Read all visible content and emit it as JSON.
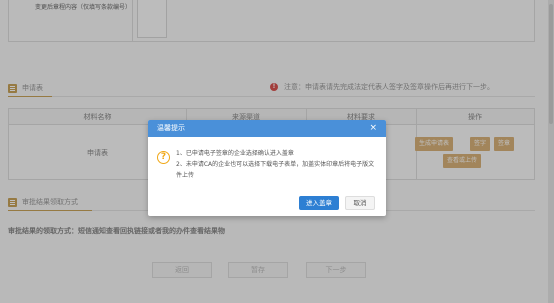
{
  "form": {
    "change_content_label": "变更后章程内容（仅填写条款编号）"
  },
  "application_section": {
    "title": "申请表",
    "notice": "注意：申请表请先完成法定代表人签字及签章操作后再进行下一步。",
    "notice_icon": "alert-icon"
  },
  "table": {
    "headers": [
      "材料名称",
      "来源渠道",
      "材料要求",
      "操作"
    ],
    "rows": [
      {
        "name": "申请表",
        "source": "",
        "requirement": ""
      }
    ],
    "actions": {
      "generate": "生成申请表",
      "sign": "签字",
      "seal": "签章",
      "view_upload": "查看或上传"
    }
  },
  "result_section": {
    "title": "审批结果领取方式",
    "method_text": "审批结果的领取方式：短信通知查看回执链接或者我的办件查看结果物"
  },
  "bottom_buttons": {
    "back": "返回",
    "save": "暂存",
    "next": "下一步"
  },
  "modal": {
    "title": "温馨提示",
    "close": "×",
    "icon": "question-icon",
    "line1": "1、已申请电子签章的企业选择确认进入盖章",
    "line2": "2、未申请CA的企业也可以选择下载电子表单，加盖实体印章后将电子版文件上传",
    "primary_button": "进入盖章",
    "cancel_button": "取消"
  },
  "colors": {
    "accent": "#2d7fd3",
    "modal_header": "#4a90d9",
    "action_button": "#d8b27a",
    "warning": "#f0a818",
    "error_dot": "#d9534f"
  }
}
